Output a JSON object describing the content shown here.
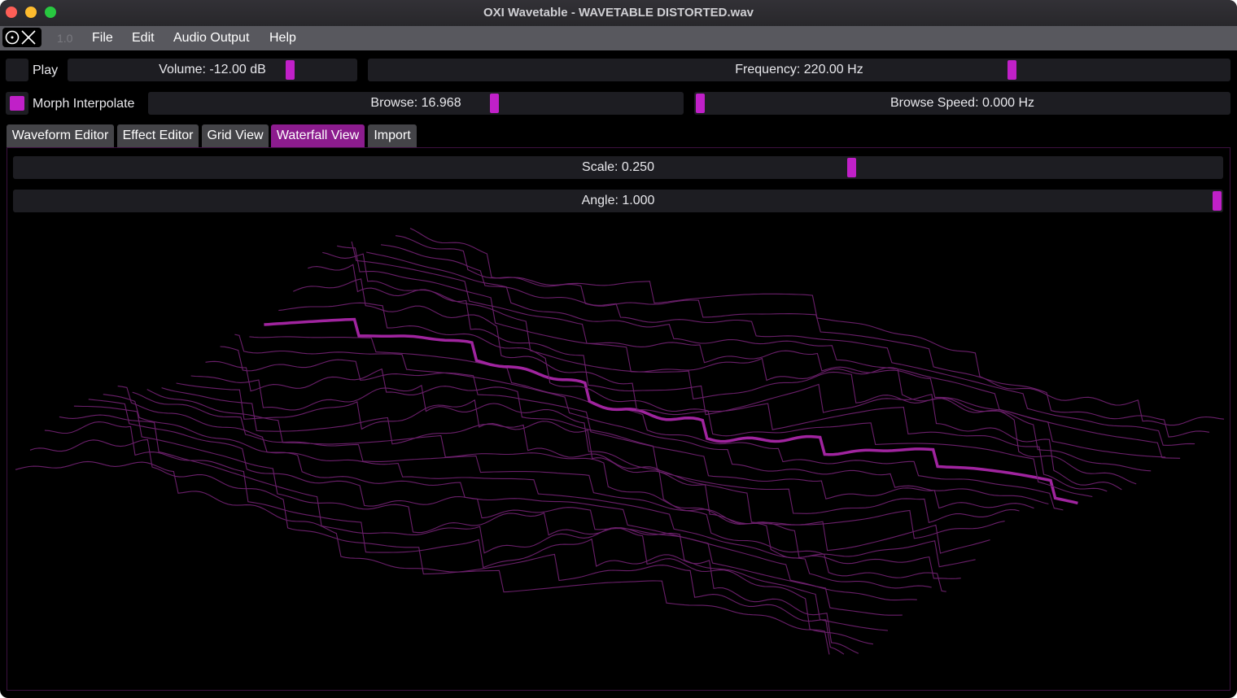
{
  "window": {
    "title": "OXI Wavetable - WAVETABLE DISTORTED.wav"
  },
  "menubar": {
    "version": "1.0",
    "items": [
      "File",
      "Edit",
      "Audio Output",
      "Help"
    ]
  },
  "controls": {
    "play_label": "Play",
    "volume_label": "Volume: -12.00 dB",
    "volume_level": 0.78,
    "frequency_label": "Frequency: 220.00 Hz",
    "frequency_level": 0.75,
    "morph_label": "Morph Interpolate",
    "morph_checked": true,
    "browse_label": "Browse: 16.968",
    "browse_level": 0.65,
    "browse_speed_label": "Browse Speed: 0.000 Hz",
    "browse_speed_level": 0.0
  },
  "tabs": [
    {
      "label": "Waveform Editor",
      "active": false
    },
    {
      "label": "Effect Editor",
      "active": false
    },
    {
      "label": "Grid View",
      "active": false
    },
    {
      "label": "Waterfall View",
      "active": true
    },
    {
      "label": "Import",
      "active": false
    }
  ],
  "waterfall": {
    "scale_label": "Scale: 0.250",
    "scale_level": 0.695,
    "angle_label": "Angle: 1.000",
    "angle_level": 1.0
  },
  "colors": {
    "accent": "#c020c8",
    "tab_active": "#8c1c8e",
    "wave_line": "#6a1f6a",
    "wave_highlight": "#a0249f"
  },
  "icons": {
    "logo": "oxi-logo-icon"
  }
}
